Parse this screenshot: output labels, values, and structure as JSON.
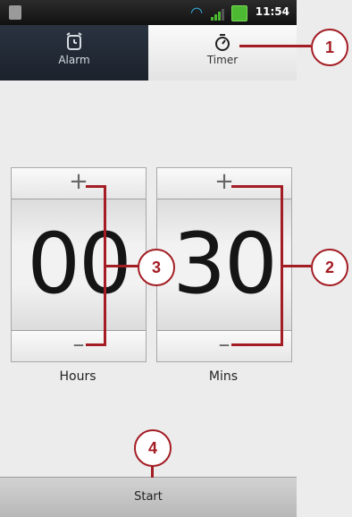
{
  "status_bar": {
    "time": "11:54",
    "wifi_icon": "wifi-icon",
    "signal_icon": "signal-icon",
    "battery_icon": "battery-icon"
  },
  "tabs": [
    {
      "label": "Alarm",
      "icon": "alarm-clock-icon",
      "selected": false
    },
    {
      "label": "Timer",
      "icon": "stopwatch-icon",
      "selected": true
    }
  ],
  "timer": {
    "hours": {
      "value": "00",
      "caption": "Hours",
      "plus": "+",
      "minus": "–"
    },
    "mins": {
      "value": "30",
      "caption": "Mins",
      "plus": "+",
      "minus": "–"
    }
  },
  "start_label": "Start",
  "callouts": [
    "1",
    "2",
    "3",
    "4"
  ],
  "colors": {
    "accent": "#a31d24",
    "tab_dark": "#1b222c",
    "background": "#ececec"
  }
}
